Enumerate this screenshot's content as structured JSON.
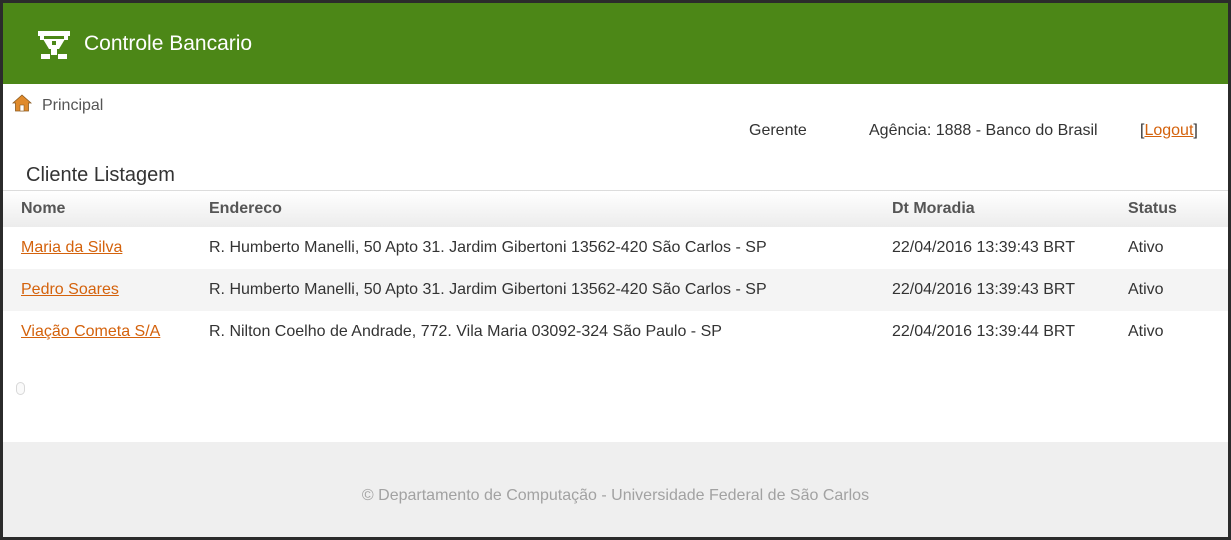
{
  "app": {
    "title": "Controle Bancario"
  },
  "breadcrumb": {
    "label": "Principal"
  },
  "user_bar": {
    "role": "Gerente",
    "agency": "Agência: 1888 - Banco do Brasil",
    "logout_open": "[",
    "logout_label": "Logout",
    "logout_close": "]"
  },
  "page": {
    "title": "Cliente Listagem"
  },
  "table": {
    "headers": {
      "name": "Nome",
      "address": "Endereco",
      "date": "Dt Moradia",
      "status": "Status"
    },
    "rows": [
      {
        "name": "Maria da Silva",
        "address": "R. Humberto Manelli, 50 Apto 31. Jardim Gibertoni 13562-420 São Carlos - SP",
        "date": "22/04/2016 13:39:43 BRT",
        "status": "Ativo"
      },
      {
        "name": "Pedro Soares",
        "address": "R. Humberto Manelli, 50 Apto 31. Jardim Gibertoni 13562-420 São Carlos - SP",
        "date": "22/04/2016 13:39:43 BRT",
        "status": "Ativo"
      },
      {
        "name": "Viação Cometa S/A",
        "address": "R. Nilton Coelho de Andrade, 772. Vila Maria 03092-324 São Paulo - SP",
        "date": "22/04/2016 13:39:44 BRT",
        "status": "Ativo"
      }
    ]
  },
  "footer": {
    "text": "© Departamento de Computação - Universidade Federal de São Carlos"
  },
  "colors": {
    "navbar": "#4c8717",
    "link": "#d4620c",
    "footer_bg": "#efefef"
  },
  "icons": {
    "brand": "bank-logo-icon",
    "home": "home-icon"
  }
}
